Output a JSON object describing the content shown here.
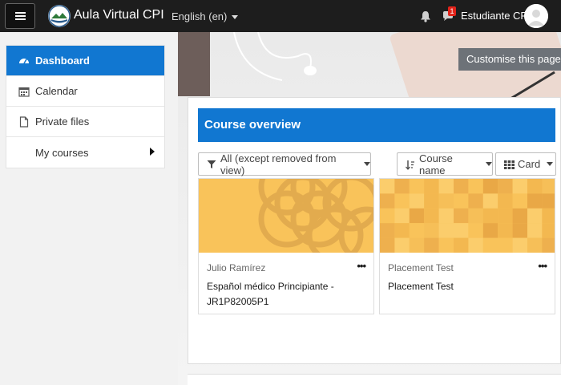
{
  "header": {
    "site_name": "Aula Virtual CPI",
    "language": "English (en)",
    "notification_count": "1",
    "user_name": "Estudiante CPI"
  },
  "sidebar": {
    "items": [
      {
        "label": "Dashboard",
        "icon": "dashboard-icon",
        "active": true
      },
      {
        "label": "Calendar",
        "icon": "calendar-icon",
        "active": false
      },
      {
        "label": "Private files",
        "icon": "file-icon",
        "active": false
      },
      {
        "label": "My courses",
        "icon": "",
        "active": false
      }
    ]
  },
  "page": {
    "customise_label": "Customise this page"
  },
  "course_overview": {
    "title": "Course overview",
    "filter_label": "All (except removed from view)",
    "sort_label": "Course name",
    "view_label": "Card",
    "courses": [
      {
        "category": "Julio Ramírez",
        "name": "Español médico Principiante -JR1P82005P1"
      },
      {
        "category": "Placement Test",
        "name": "Placement Test"
      }
    ]
  },
  "colors": {
    "primary": "#1177d1",
    "navbar": "#1d1d1d",
    "badge": "#e2231a",
    "card_image": "#f9c35a"
  }
}
